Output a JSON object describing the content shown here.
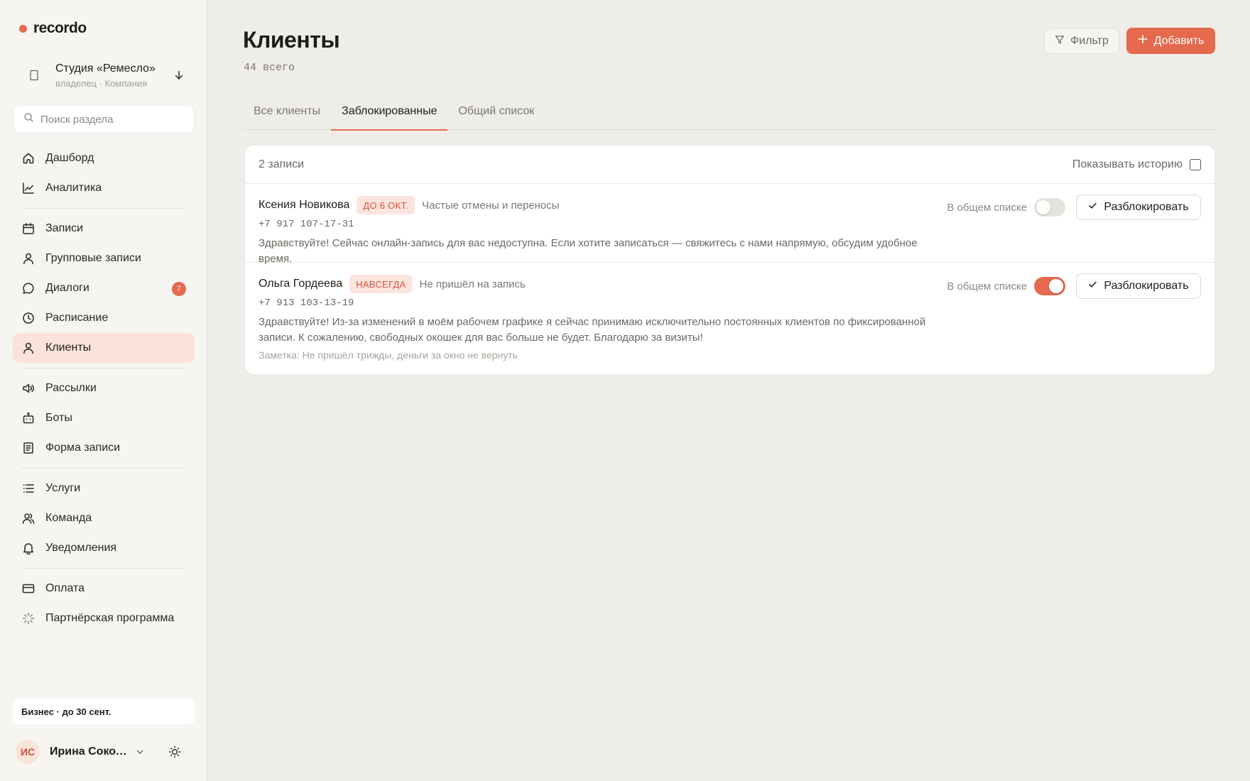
{
  "app": {
    "logo": "recordo",
    "accent_color": "#e4694d"
  },
  "workspace": {
    "name": "Студия «Ремесло»",
    "role": "владелец · Компания",
    "icon": "building-icon"
  },
  "search": {
    "placeholder": "Поиск раздела"
  },
  "nav": {
    "items": [
      {
        "label": "Дашборд",
        "icon": "home-icon"
      },
      {
        "label": "Аналитика",
        "icon": "chart-line-icon"
      },
      {
        "label": "Записи",
        "icon": "calendar-icon"
      },
      {
        "label": "Групповые записи",
        "icon": "person-icon"
      },
      {
        "label": "Диалоги",
        "icon": "chat-icon",
        "badge": "7"
      },
      {
        "label": "Расписание",
        "icon": "clock-icon"
      },
      {
        "label": "Клиенты",
        "icon": "user-icon",
        "active": true
      },
      {
        "label": "Рассылки",
        "icon": "megaphone-icon"
      },
      {
        "label": "Боты",
        "icon": "bot-icon"
      },
      {
        "label": "Форма записи",
        "icon": "form-icon"
      },
      {
        "label": "Услуги",
        "icon": "list-icon"
      },
      {
        "label": "Команда",
        "icon": "team-icon"
      },
      {
        "label": "Уведомления",
        "icon": "bell-icon"
      },
      {
        "label": "Оплата",
        "icon": "card-icon"
      },
      {
        "label": "Партнёрская программа",
        "icon": "sparkle-icon"
      }
    ]
  },
  "plan": {
    "label": "Бизнес · до 30 сент."
  },
  "user": {
    "initials": "ИС",
    "name": "Ирина Сокол..."
  },
  "page": {
    "title": "Клиенты",
    "subtitle": "44 всего"
  },
  "toolbar": {
    "filter_label": "Фильтр",
    "add_label": "Добавить"
  },
  "tabs": [
    {
      "label": "Все клиенты"
    },
    {
      "label": "Заблокированные",
      "active": true
    },
    {
      "label": "Общий список"
    }
  ],
  "blocked": {
    "count_label": "2 записи",
    "history_label": "Показывать историю",
    "history_checked": false,
    "list_label": "В общем списке",
    "unblock_label": "Разблокировать",
    "rows": [
      {
        "name": "Ксения Новикова",
        "tag": "ДО 6 ОКТ.",
        "reason": "Частые отмены и переносы",
        "phone": "+7 917 107-17-31",
        "message": "Здравствуйте! Сейчас онлайн-запись для вас недоступна. Если хотите записаться — свяжитесь с нами напрямую, обсудим удобное время.",
        "in_list": false
      },
      {
        "name": "Ольга Гордеева",
        "tag": "НАВСЕГДА",
        "reason": "Не пришёл на запись",
        "phone": "+7 913 103-13-19",
        "message": "Здравствуйте! Из-за изменений в моём рабочем графике я сейчас принимаю исключительно постоянных клиентов по фиксированной записи. К сожалению, свободных окошек для вас больше не будет. Благодарю за визиты!",
        "note": "Заметка: Не пришёл трижды, деньги за окно не вернуть",
        "in_list": true
      }
    ]
  }
}
